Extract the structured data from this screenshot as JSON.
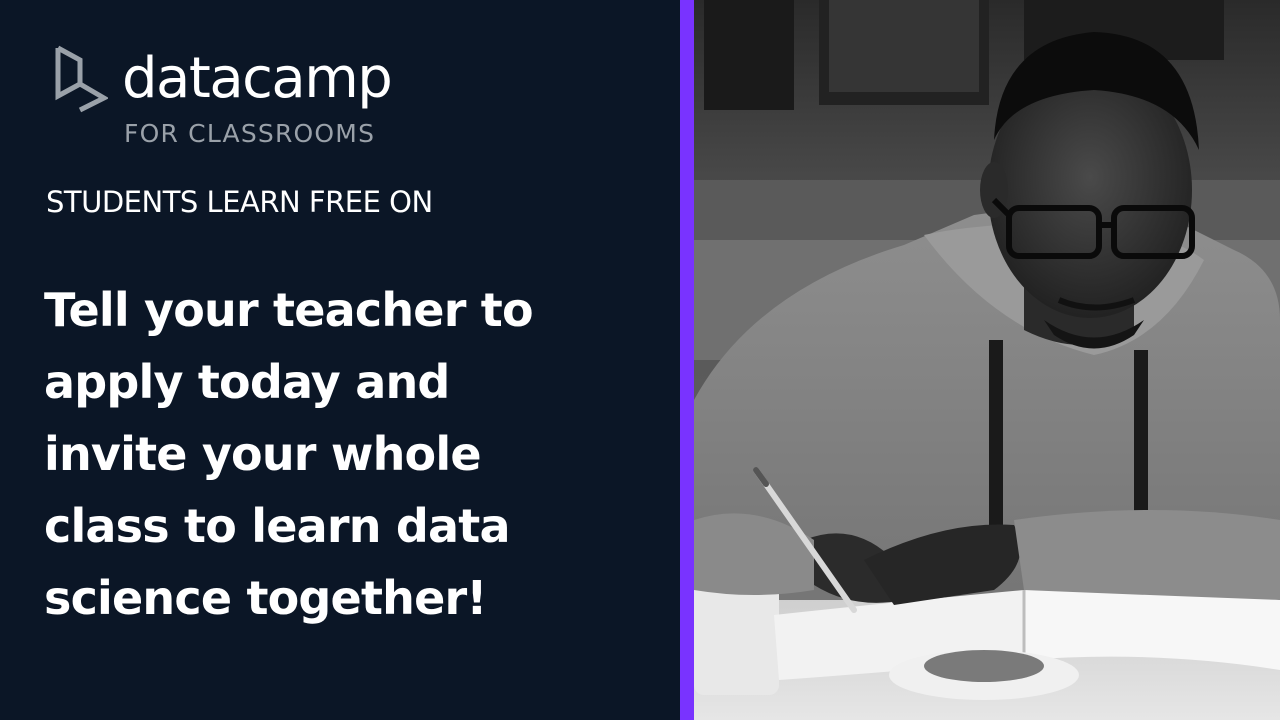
{
  "brand": {
    "name": "datacamp",
    "tagline": "FOR CLASSROOMS",
    "logo_icon": "datacamp-logo-icon"
  },
  "eyebrow": "STUDENTS LEARN FREE ON",
  "headline": {
    "lines": [
      "Tell your teacher to",
      "apply today and",
      "invite your whole",
      "class to learn data",
      "science together!"
    ]
  },
  "photo": {
    "subject": "student-writing-photo"
  },
  "colors": {
    "background": "#0b1626",
    "accent": "#7933ff",
    "text_primary": "#ffffff",
    "text_secondary": "#9aa1a9"
  }
}
